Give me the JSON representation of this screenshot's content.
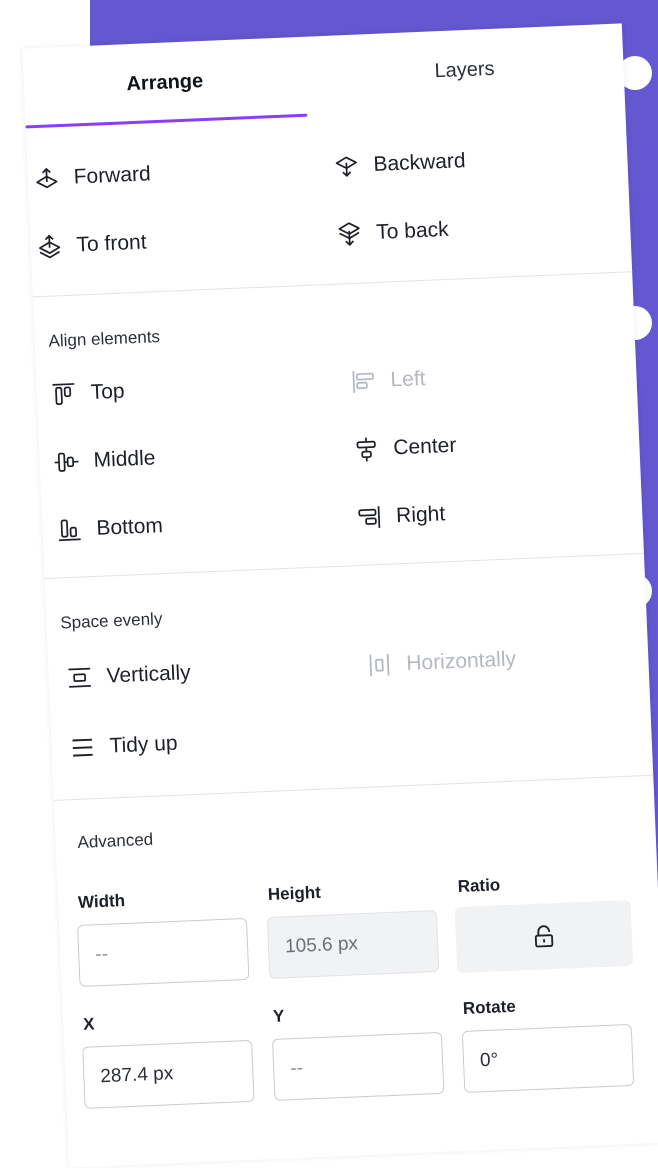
{
  "tabs": {
    "arrange": "Arrange",
    "layers": "Layers"
  },
  "order": {
    "forward": "Forward",
    "backward": "Backward",
    "to_front": "To front",
    "to_back": "To back"
  },
  "align": {
    "title": "Align elements",
    "top": "Top",
    "left": "Left",
    "middle": "Middle",
    "center": "Center",
    "bottom": "Bottom",
    "right": "Right"
  },
  "space": {
    "title": "Space evenly",
    "vertically": "Vertically",
    "horizontally": "Horizontally",
    "tidy_up": "Tidy up"
  },
  "advanced": {
    "title": "Advanced",
    "width_label": "Width",
    "width_value": "--",
    "height_label": "Height",
    "height_value": "105.6 px",
    "ratio_label": "Ratio",
    "x_label": "X",
    "x_value": "287.4 px",
    "y_label": "Y",
    "y_value": "--",
    "rotate_label": "Rotate",
    "rotate_value": "0°"
  },
  "colors": {
    "accent": "#8b3dff",
    "background": "#6457cf",
    "disabled": "#b4b8bf"
  }
}
